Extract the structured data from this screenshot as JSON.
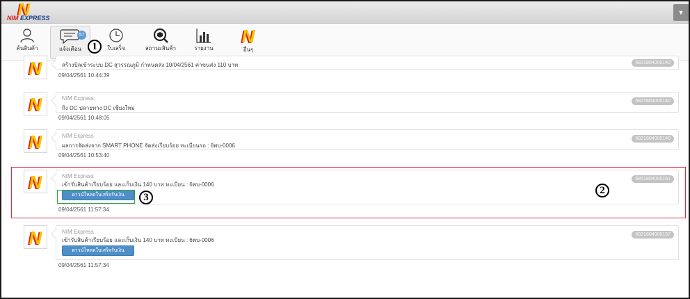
{
  "app": {
    "logo_mark": "N",
    "logo_word_1": "NIM",
    "logo_word_2": "EXPRESS",
    "menu_toggle_icon": "chevron-down-icon"
  },
  "toolbar": {
    "items": [
      {
        "icon": "user-icon",
        "label": "ค้นสินค้า"
      },
      {
        "icon": "chat-bubble-icon",
        "label": "แจ้งเตือน",
        "badge": "57",
        "active": true
      },
      {
        "icon": "clock-icon",
        "label": "ใบเสร็จ"
      },
      {
        "icon": "package-search-icon",
        "label": "สถานะสินค้า"
      },
      {
        "icon": "bar-chart-icon",
        "label": "รายงาน"
      },
      {
        "icon": "nim-logo-icon",
        "label": "อื่นๆ"
      }
    ]
  },
  "feed": {
    "entries": [
      {
        "sender": "",
        "message": "สร้างบิลเข้าระบบ DC สุวรรณภูมิ กำหนดส่ง 10/04/2561 ค่าขนส่ง 110 บาท",
        "tracking": "6821804000140",
        "timestamp": "09/04/2561 10:44:39"
      },
      {
        "sender": "NIM Express",
        "message": "ถึง DC ปลายทาง DC เชียงใหม่",
        "tracking": "6821804000140",
        "timestamp": "09/04/2561 10:48:05"
      },
      {
        "sender": "NIM Express",
        "message": "ผลการจัดส่งจาก SMART PHONE จัดส่งเรียบร้อย ทะเบียนรถ : 6พบ-0006",
        "tracking": "6821804000140",
        "timestamp": "09/04/2561 10:53:40"
      },
      {
        "sender": "NIM Express",
        "message": "เข้ารับสินค้าเรียบร้อย และเก็บเงิน 140 บาท ทะเบียน : 6พบ-0006",
        "tracking": "6851804000161",
        "button": "ดาวน์โหลดใบเสร็จรับเงิน",
        "timestamp": "09/04/2561 11:57:34"
      },
      {
        "sender": "NIM Express",
        "message": "เข้ารับสินค้าเรียบร้อย และเก็บเงิน 140 บาท ทะเบียน : 6พบ-0006",
        "tracking": "6821804000157",
        "button": "ดาวน์โหลดใบเสร็จรับเงิน",
        "timestamp": "09/04/2561 11:57:34"
      }
    ]
  },
  "annotations": {
    "callout_1": "1",
    "callout_2": "2",
    "callout_3": "3",
    "highlight_entry_color": "#e02a36",
    "highlight_button_color": "#2da04a"
  },
  "colors": {
    "brand_yellow": "#f5c400",
    "brand_red": "#d8231e",
    "button_blue": "#4f8fc8",
    "badge_blue": "#5b9bd5"
  }
}
